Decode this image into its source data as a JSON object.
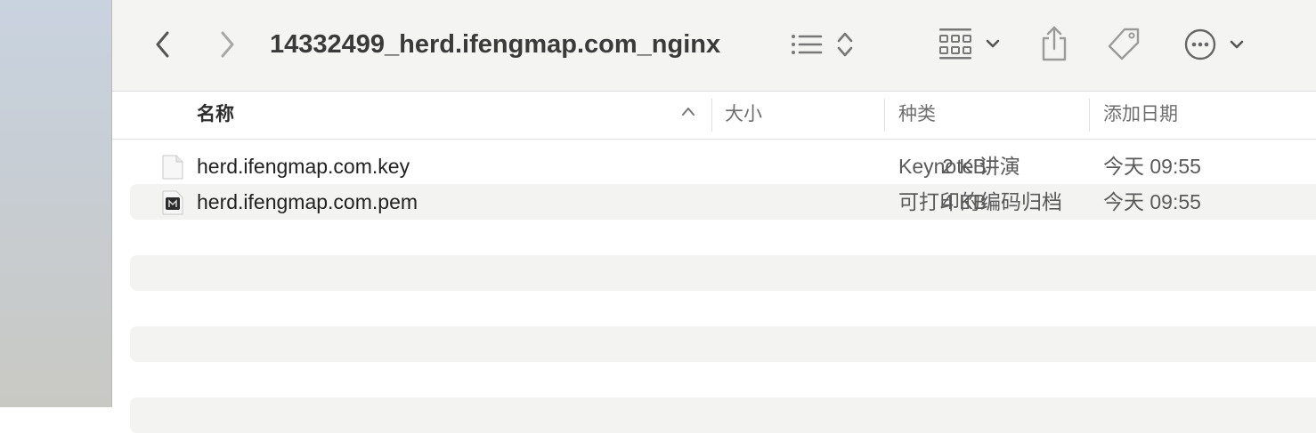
{
  "window": {
    "title": "14332499_herd.ifengmap.com_nginx"
  },
  "toolbar": {
    "icons": [
      "back-chevron-icon",
      "forward-chevron-icon",
      "list-view-icon",
      "sort-updown-icon",
      "group-grid-icon",
      "chevron-down-icon",
      "share-icon",
      "tag-icon",
      "more-ellipsis-icon",
      "chevron-down-icon"
    ]
  },
  "columns": {
    "name": "名称",
    "size": "大小",
    "kind": "种类",
    "date_added": "添加日期"
  },
  "files": [
    {
      "name": "herd.ifengmap.com.key",
      "size": "2 KB",
      "kind": "Keynote 讲演",
      "date": "今天 09:55",
      "icon": "blank-document-icon"
    },
    {
      "name": "herd.ifengmap.com.pem",
      "size": "4 KB",
      "kind": "可打印的编码归档",
      "date": "今天 09:55",
      "icon": "certificate-document-icon"
    }
  ],
  "colors": {
    "toolbar_bg": "#f4f4f2",
    "stripe_bg": "#f3f3f1",
    "icon_gray": "#7a7a7a"
  }
}
